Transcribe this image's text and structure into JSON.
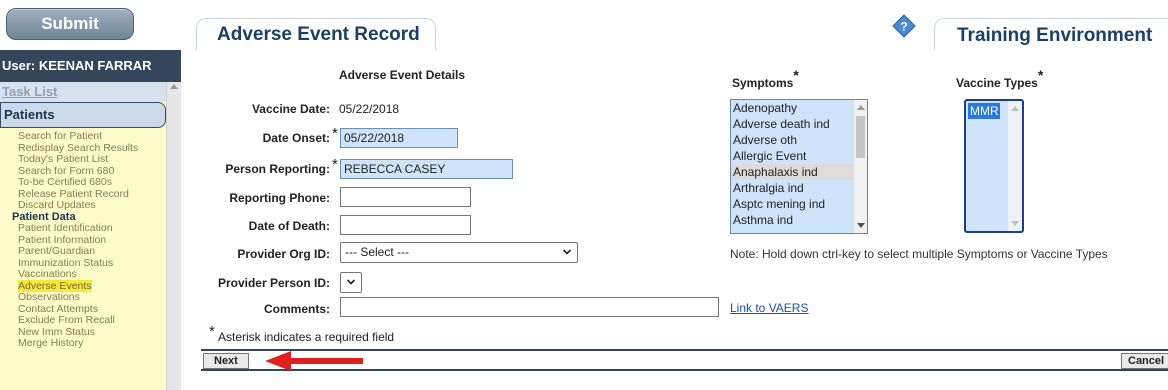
{
  "toolbar": {
    "submit_label": "Submit"
  },
  "header": {
    "form_title": "Adverse Event Record",
    "environment": "Training Environment"
  },
  "sidebar": {
    "user": "User: KEENAN FARRAR",
    "task_list": "Task List",
    "patients_header": "Patients",
    "items": [
      {
        "label": "Search for Patient"
      },
      {
        "label": "Redisplay Search Results"
      },
      {
        "label": "Today's Patient List"
      },
      {
        "label": "Search for Form 680"
      },
      {
        "label": "To-be Certified 680s"
      },
      {
        "label": "Release Patient Record"
      },
      {
        "label": "Discard Updates"
      },
      {
        "label": "Patient Data",
        "header": true
      },
      {
        "label": "Patient Identification"
      },
      {
        "label": "Patient Information"
      },
      {
        "label": "Parent/Guardian"
      },
      {
        "label": "Immunization Status"
      },
      {
        "label": "Vaccinations"
      },
      {
        "label": "Adverse Events",
        "active": true
      },
      {
        "label": "Observations"
      },
      {
        "label": "Contact Attempts"
      },
      {
        "label": "Exclude From Recall"
      },
      {
        "label": "New Imm Status"
      },
      {
        "label": "Merge History"
      }
    ]
  },
  "form": {
    "section_title": "Adverse Event Details",
    "vaccine_date_label": "Vaccine Date:",
    "vaccine_date_value": "05/22/2018",
    "date_onset_label": "Date Onset:",
    "date_onset_value": "05/22/2018",
    "person_reporting_label": "Person Reporting:",
    "person_reporting_value": "REBECCA CASEY",
    "reporting_phone_label": "Reporting Phone:",
    "reporting_phone_value": "",
    "date_of_death_label": "Date of Death:",
    "date_of_death_value": "",
    "provider_org_label": "Provider Org ID:",
    "provider_org_value": "--- Select ---",
    "provider_person_label": "Provider Person ID:",
    "comments_label": "Comments:",
    "comments_value": "",
    "required_star": "*",
    "required_note": "Asterisk indicates a required field",
    "vaers_link": "Link to VAERS"
  },
  "symptoms": {
    "title": "Symptoms",
    "options": [
      "Adenopathy",
      "Adverse death ind",
      "Adverse oth",
      "Allergic Event",
      "Anaphalaxis ind",
      "Arthralgia ind",
      "Asptc mening ind",
      "Asthma ind"
    ],
    "highlighted": "Anaphalaxis ind"
  },
  "vaccine_types": {
    "title": "Vaccine Types",
    "selected": "MMR"
  },
  "note": "Note: Hold down ctrl-key to select multiple Symptoms or Vaccine Types",
  "footer": {
    "next_label": "Next",
    "cancel_label": "Cancel"
  },
  "colors": {
    "header_navy": "#34475a",
    "title_blue": "#1c3f66",
    "nav_panel": "#fdfbc8",
    "nav_highlight": "#f2e93a",
    "field_fill": "#cfe4fb",
    "selection_blue": "#2b78e4",
    "annotation_arrow": "#e0201c"
  },
  "icons": [
    "help-diamond-icon",
    "chevron-down-icon",
    "scroll-arrow-icon",
    "red-arrow-annotation"
  ]
}
